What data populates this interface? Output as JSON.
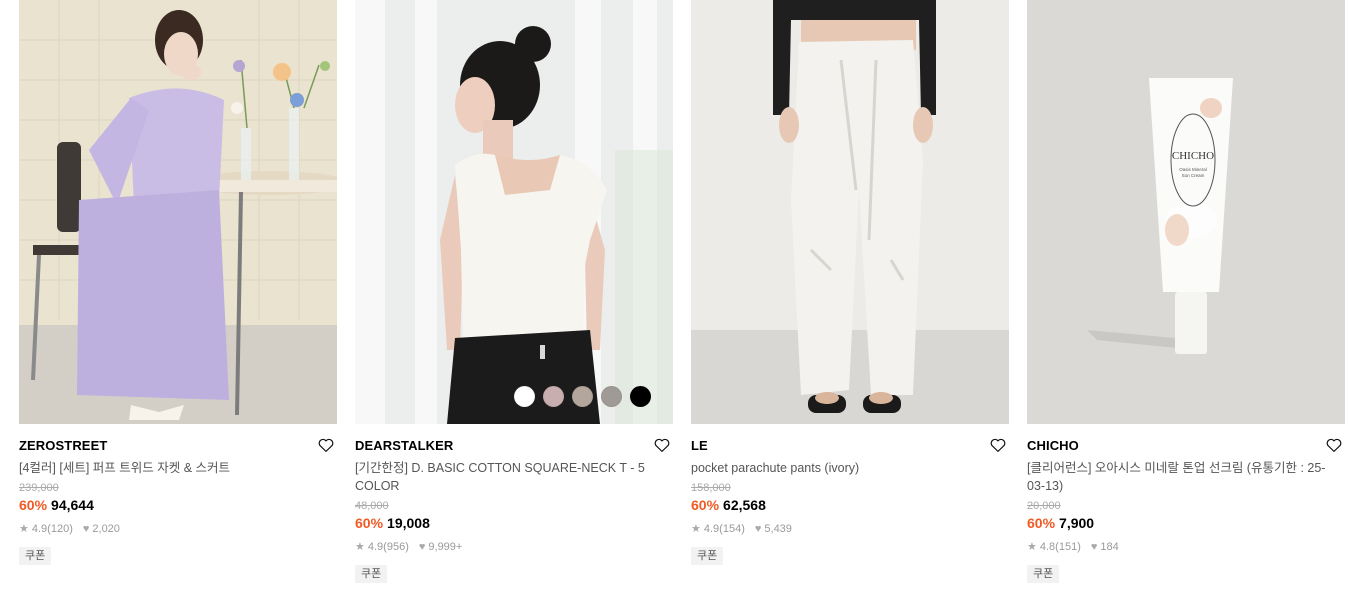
{
  "products": [
    {
      "brand": "ZEROSTREET",
      "title": "[4컬러] [세트] 퍼프 트위드 자켓 & 스커트",
      "original_price": "239,000",
      "discount": "60%",
      "price": "94,644",
      "rating": "4.9",
      "review_count": "(120)",
      "likes": "2,020",
      "coupon": "쿠폰",
      "image_icon": "lavender-tweed-set-photo"
    },
    {
      "brand": "DEARSTALKER",
      "title": "[기간한정] D. BASIC COTTON SQUARE-NECK T - 5 COLOR",
      "original_price": "48,000",
      "discount": "60%",
      "price": "19,008",
      "rating": "4.9",
      "review_count": "(956)",
      "likes": "9,999+",
      "coupon": "쿠폰",
      "image_icon": "white-square-neck-tee-photo",
      "swatches": [
        "#ffffff",
        "#c9aeb0",
        "#b3a69c",
        "#9f9a95",
        "#000000"
      ]
    },
    {
      "brand": "LE",
      "title": "pocket parachute pants (ivory)",
      "original_price": "158,000",
      "discount": "60%",
      "price": "62,568",
      "rating": "4.9",
      "review_count": "(154)",
      "likes": "5,439",
      "coupon": "쿠폰",
      "image_icon": "ivory-parachute-pants-photo"
    },
    {
      "brand": "CHICHO",
      "title": "[클리어런스] 오아시스 미네랄 톤업 선크림 (유통기한 : 25-03-13)",
      "original_price": "20,000",
      "discount": "60%",
      "price": "7,900",
      "rating": "4.8",
      "review_count": "(151)",
      "likes": "184",
      "coupon": "쿠폰",
      "image_icon": "sun-cream-tube-photo",
      "tube_text": {
        "brand": "CHICHO",
        "line1": "Oasis Mineral",
        "line2": "Sun Cream"
      }
    }
  ],
  "colors": {
    "discount": "#f15a24",
    "coupon_bg": "#f2f2f2",
    "muted": "#9a9a9a"
  }
}
